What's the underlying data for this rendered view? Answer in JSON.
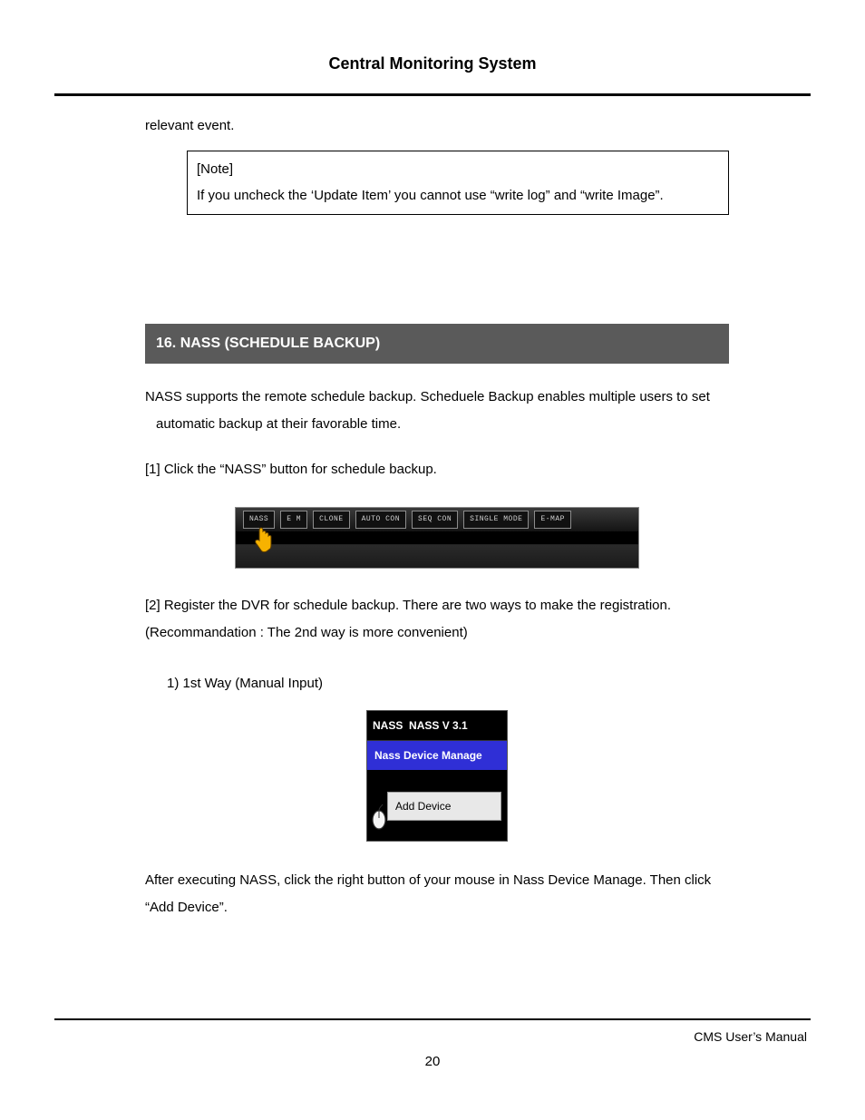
{
  "header": {
    "title": "Central Monitoring System"
  },
  "intro": {
    "relevant": "relevant event."
  },
  "note": {
    "label": "[Note]",
    "text": "If you uncheck the ‘Update Item’ you cannot use “write log” and “write Image”."
  },
  "section": {
    "heading": "16. NASS (SCHEDULE BACKUP)"
  },
  "body": {
    "p1a": "NASS supports the remote schedule backup. Scheduele Backup enables multiple users to set",
    "p1b": "automatic backup at their favorable time.",
    "step1": "[1] Click the “NASS” button for schedule backup.",
    "step2a": "[2] Register the DVR for schedule backup. There are two ways to make the registration.",
    "step2b": "(Recommandation : The 2nd way is more convenient)",
    "way1": "1) 1st Way (Manual Input)",
    "after1": "After executing NASS, click the right button of your mouse in Nass Device Manage. Then click",
    "after2": "“Add Device”."
  },
  "toolbar": {
    "buttons": [
      "NASS",
      "E M",
      "CLONE",
      "AUTO CON",
      "SEQ CON",
      "SINGLE MODE",
      "E-MAP"
    ]
  },
  "nass_window": {
    "title_prefix": "NASS",
    "title_version": "NASS V 3.1",
    "subtitle": "Nass Device Manage",
    "menu_item": "Add Device"
  },
  "footer": {
    "label": "CMS User’s Manual",
    "page": "20"
  }
}
